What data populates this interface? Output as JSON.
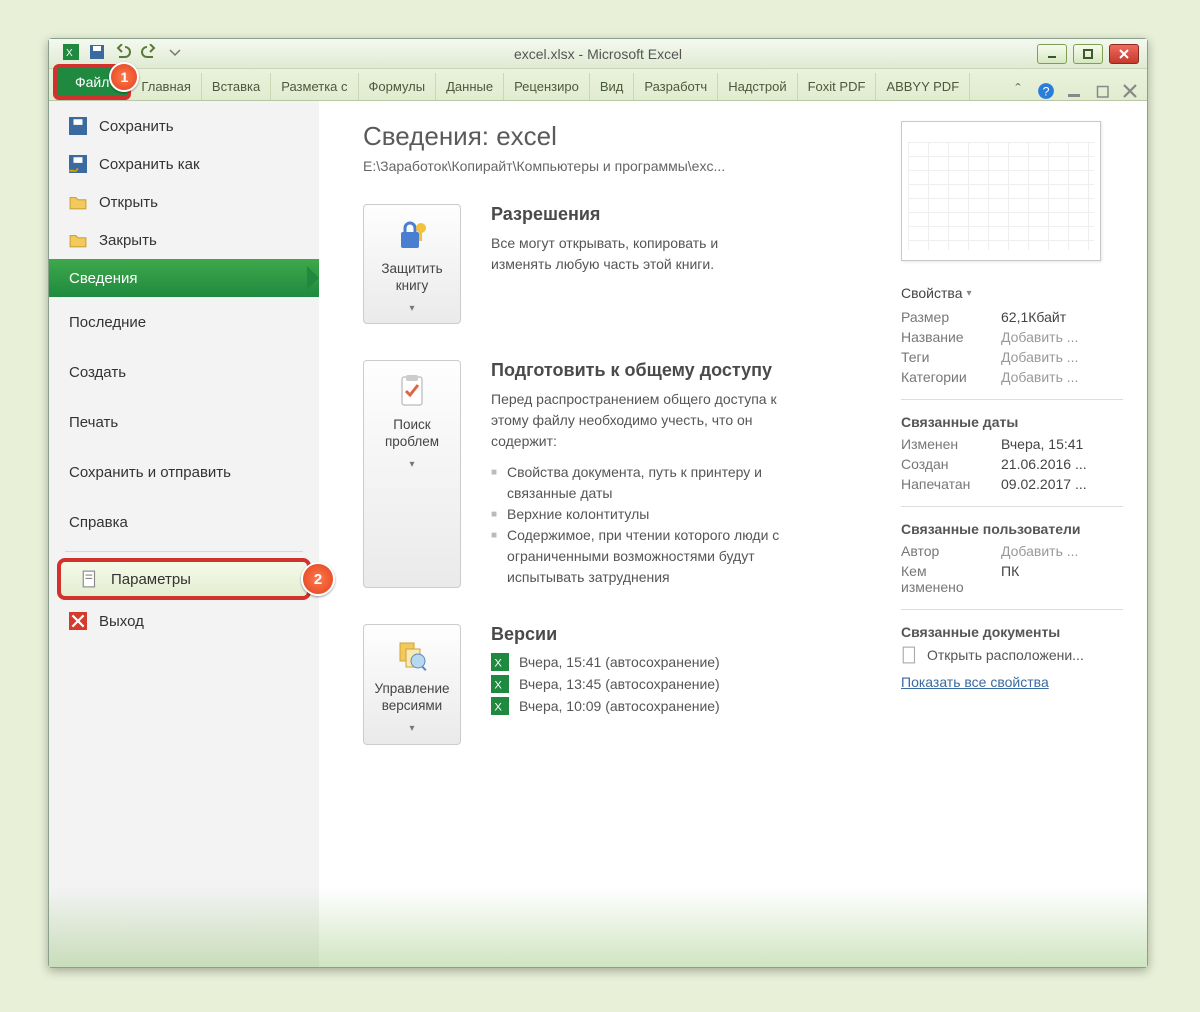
{
  "window": {
    "title": "excel.xlsx - Microsoft Excel"
  },
  "annotations": {
    "one": "1",
    "two": "2"
  },
  "tabs": {
    "file": "Файл",
    "others": [
      "Главная",
      "Вставка",
      "Разметка с",
      "Формулы",
      "Данные",
      "Рецензиро",
      "Вид",
      "Разработч",
      "Надстрой",
      "Foxit PDF",
      "ABBYY PDF"
    ]
  },
  "sidebar": {
    "save": "Сохранить",
    "save_as": "Сохранить как",
    "open": "Открыть",
    "close": "Закрыть",
    "info": "Сведения",
    "recent": "Последние",
    "new": "Создать",
    "print": "Печать",
    "save_send": "Сохранить и отправить",
    "help": "Справка",
    "options": "Параметры",
    "exit": "Выход"
  },
  "main": {
    "title": "Сведения: excel",
    "path": "E:\\Заработок\\Копирайт\\Компьютеры и программы\\exc...",
    "permissions": {
      "heading": "Разрешения",
      "text": "Все могут открывать, копировать и изменять любую часть этой книги.",
      "button": "Защитить книгу"
    },
    "prepare": {
      "heading": "Подготовить к общему доступу",
      "intro": "Перед распространением общего доступа к этому файлу необходимо учесть, что он содержит:",
      "b1": "Свойства документа, путь к принтеру и связанные даты",
      "b2": "Верхние колонтитулы",
      "b3": "Содержимое, при чтении которого люди с ограниченными возможностями будут испытывать затруднения",
      "button": "Поиск проблем"
    },
    "versions": {
      "heading": "Версии",
      "button": "Управление версиями",
      "items": [
        "Вчера, 15:41 (автосохранение)",
        "Вчера, 13:45 (автосохранение)",
        "Вчера, 10:09 (автосохранение)"
      ]
    }
  },
  "props": {
    "properties_label": "Свойства",
    "size_k": "Размер",
    "size_v": "62,1Кбайт",
    "name_k": "Название",
    "name_v": "Добавить ...",
    "tags_k": "Теги",
    "tags_v": "Добавить ...",
    "cat_k": "Категории",
    "cat_v": "Добавить ...",
    "dates_h": "Связанные даты",
    "mod_k": "Изменен",
    "mod_v": "Вчера, 15:41",
    "created_k": "Создан",
    "created_v": "21.06.2016 ...",
    "printed_k": "Напечатан",
    "printed_v": "09.02.2017 ...",
    "users_h": "Связанные пользователи",
    "author_k": "Автор",
    "author_v": "Добавить ...",
    "changed_k": "Кем изменено",
    "changed_v": "ПК",
    "docs_h": "Связанные документы",
    "openloc": "Открыть расположени...",
    "showall": "Показать все свойства"
  }
}
